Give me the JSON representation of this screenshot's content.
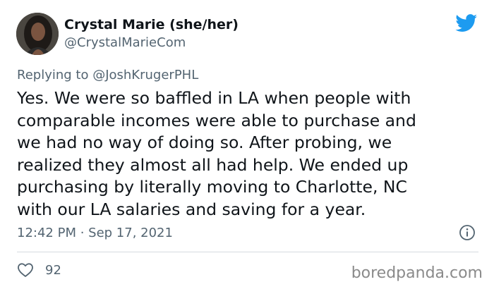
{
  "author": {
    "name": "Crystal Marie (she/her)",
    "handle": "@CrystalMarieCom"
  },
  "reply": {
    "prefix": "Replying to ",
    "mention": "@JoshKrugerPHL"
  },
  "tweet": {
    "text": "Yes. We were so baffled in LA when people with\ncomparable incomes were able to purchase and\nwe had no way of doing so. After probing, we\nrealized they almost all had help. We ended up\npurchasing by literally moving to Charlotte, NC\nwith our LA salaries and saving for a year.",
    "timestamp": "12:42 PM · Sep 17, 2021"
  },
  "stats": {
    "likes": "92"
  },
  "watermark": "boredpanda.com",
  "icons": {
    "brand": "twitter-bird-icon",
    "info": "info-icon",
    "like": "heart-icon"
  },
  "colors": {
    "twitter_blue": "#1d9bf0",
    "secondary_text": "#536471",
    "primary_text": "#0f1419"
  }
}
